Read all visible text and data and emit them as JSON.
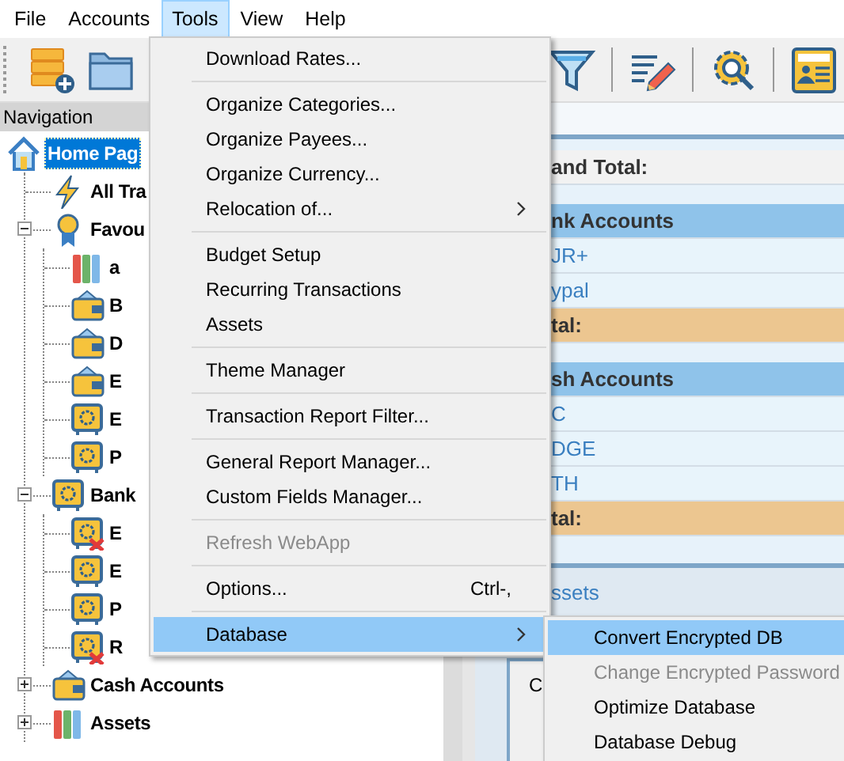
{
  "menubar": [
    {
      "label": "File",
      "selected": false
    },
    {
      "label": "Accounts",
      "selected": false
    },
    {
      "label": "Tools",
      "selected": true
    },
    {
      "label": "View",
      "selected": false
    },
    {
      "label": "Help",
      "selected": false
    }
  ],
  "toolbar": {
    "left": [
      {
        "kind": "database"
      },
      {
        "kind": "folder"
      }
    ],
    "right": [
      {
        "kind": "funnel"
      },
      {
        "kind": "pencil"
      },
      {
        "kind": "gear"
      },
      {
        "kind": "news"
      }
    ]
  },
  "navigation": {
    "title": "Navigation",
    "tree": [
      {
        "label": "Home Pag",
        "kind": "home",
        "selected": true,
        "children": [
          {
            "label": "All Tra",
            "kind": "lightning",
            "selected": false
          },
          {
            "label": "Favou",
            "kind": "ribbon",
            "selected": false,
            "expanded": true,
            "children": [
              {
                "label": "a",
                "kind": "books",
                "selected": false
              },
              {
                "label": "B",
                "kind": "wallet",
                "selected": false
              },
              {
                "label": "D",
                "kind": "wallet",
                "selected": false
              },
              {
                "label": "E",
                "kind": "wallet",
                "selected": false
              },
              {
                "label": "E",
                "kind": "safe",
                "selected": false
              },
              {
                "label": "P",
                "kind": "safe",
                "selected": false
              }
            ]
          },
          {
            "label": "Bank",
            "kind": "safe",
            "selected": false,
            "expanded": true,
            "children": [
              {
                "label": "E",
                "kind": "safe-closed",
                "selected": false
              },
              {
                "label": "E",
                "kind": "safe",
                "selected": false
              },
              {
                "label": "P",
                "kind": "safe",
                "selected": false
              },
              {
                "label": "R",
                "kind": "safe-closed",
                "selected": false
              }
            ]
          },
          {
            "label": "Cash Accounts",
            "kind": "wallet",
            "selected": false,
            "expanded": false
          },
          {
            "label": "Assets",
            "kind": "books",
            "selected": false,
            "expanded": false
          }
        ]
      }
    ]
  },
  "summary": {
    "rows": [
      {
        "kind": "total",
        "text": "and Total:"
      },
      {
        "kind": "header",
        "text": "nk Accounts"
      },
      {
        "kind": "account",
        "text": "JR+"
      },
      {
        "kind": "account",
        "text": "ypal"
      },
      {
        "kind": "subtotal",
        "text": "tal:"
      },
      {
        "kind": "header",
        "text": "sh Accounts"
      },
      {
        "kind": "account",
        "text": "C"
      },
      {
        "kind": "account",
        "text": "DGE"
      },
      {
        "kind": "account",
        "text": "TH"
      },
      {
        "kind": "subtotal",
        "text": "tal:"
      }
    ],
    "lower_link": "ssets",
    "lower_box_text": "C"
  },
  "tools_menu": [
    {
      "kind": "item",
      "label": "Download Rates...",
      "selected": false,
      "disabled": false
    },
    {
      "kind": "separator"
    },
    {
      "kind": "item",
      "label": "Organize Categories...",
      "selected": false,
      "disabled": false
    },
    {
      "kind": "item",
      "label": "Organize Payees...",
      "selected": false,
      "disabled": false
    },
    {
      "kind": "item",
      "label": "Organize Currency...",
      "selected": false,
      "disabled": false
    },
    {
      "kind": "item",
      "label": "Relocation of...",
      "selected": false,
      "disabled": false,
      "submenu": true
    },
    {
      "kind": "separator"
    },
    {
      "kind": "item",
      "label": "Budget Setup",
      "selected": false,
      "disabled": false
    },
    {
      "kind": "item",
      "label": "Recurring Transactions",
      "selected": false,
      "disabled": false
    },
    {
      "kind": "item",
      "label": "Assets",
      "selected": false,
      "disabled": false
    },
    {
      "kind": "separator"
    },
    {
      "kind": "item",
      "label": "Theme Manager",
      "selected": false,
      "disabled": false
    },
    {
      "kind": "separator"
    },
    {
      "kind": "item",
      "label": "Transaction Report Filter...",
      "selected": false,
      "disabled": false
    },
    {
      "kind": "separator"
    },
    {
      "kind": "item",
      "label": "General Report Manager...",
      "selected": false,
      "disabled": false
    },
    {
      "kind": "item",
      "label": "Custom Fields Manager...",
      "selected": false,
      "disabled": false
    },
    {
      "kind": "separator"
    },
    {
      "kind": "item",
      "label": "Refresh WebApp",
      "selected": false,
      "disabled": true
    },
    {
      "kind": "separator"
    },
    {
      "kind": "item",
      "label": "Options...",
      "shortcut": "Ctrl-,",
      "selected": false,
      "disabled": false
    },
    {
      "kind": "separator"
    },
    {
      "kind": "item",
      "label": "Database",
      "selected": true,
      "disabled": false,
      "submenu": true
    }
  ],
  "database_submenu": [
    {
      "kind": "item",
      "label": "Convert Encrypted DB",
      "selected": true,
      "disabled": false
    },
    {
      "kind": "item",
      "label": "Change Encrypted Password",
      "selected": false,
      "disabled": true
    },
    {
      "kind": "item",
      "label": "Optimize Database",
      "selected": false,
      "disabled": false
    },
    {
      "kind": "item",
      "label": "Database Debug",
      "selected": false,
      "disabled": false
    }
  ]
}
